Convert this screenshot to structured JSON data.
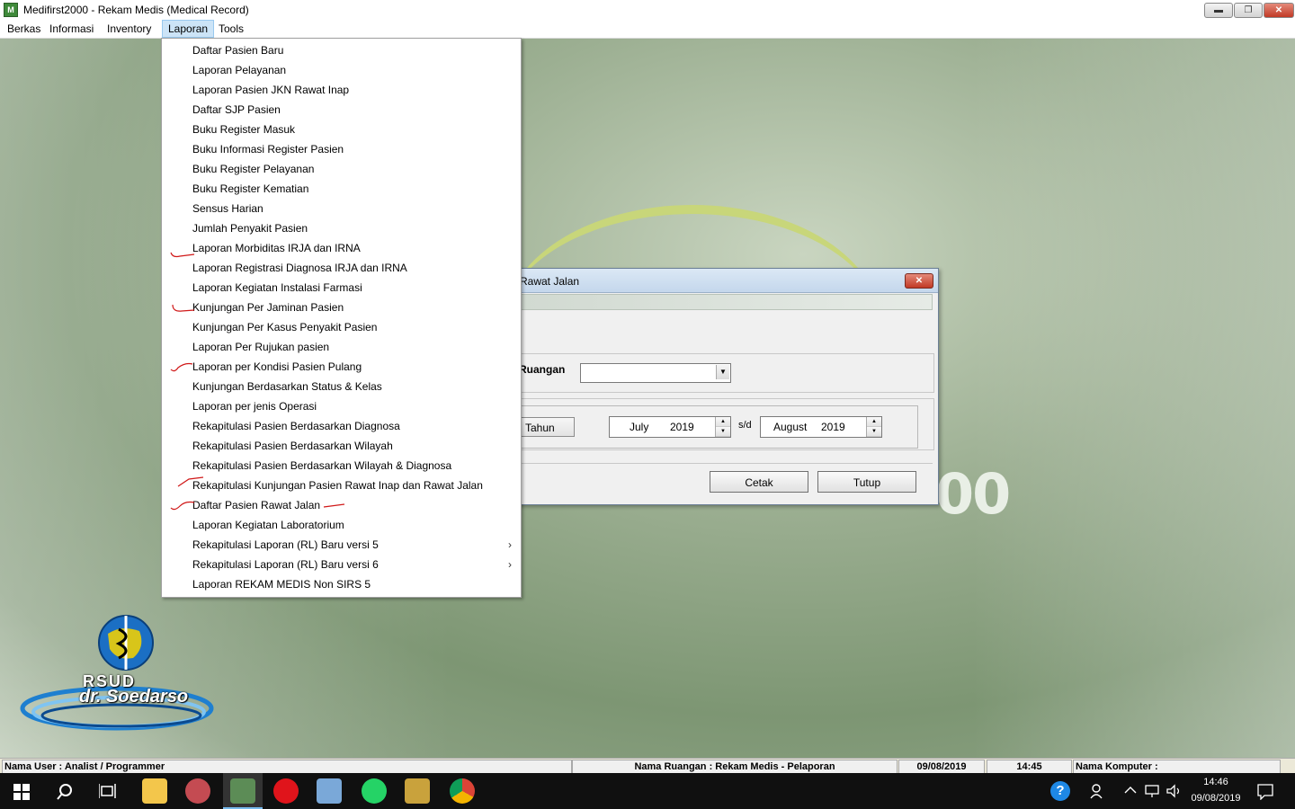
{
  "window": {
    "title": "Medifirst2000 - Rekam Medis (Medical Record)",
    "minimize": "▬",
    "restore": "❐",
    "close": "✕"
  },
  "menubar": {
    "items": [
      "Berkas",
      "Informasi",
      "Inventory",
      "Laporan",
      "Tools"
    ],
    "active": "Laporan"
  },
  "background": {
    "brand_fragment": "00",
    "copyright": "©",
    "hospital_logo": {
      "line1": "RSUD",
      "line2": "dr. Soedarso"
    }
  },
  "laporan_menu": {
    "items": [
      {
        "label": "Daftar Pasien Baru"
      },
      {
        "label": "Laporan Pelayanan"
      },
      {
        "label": "Laporan Pasien JKN Rawat Inap"
      },
      {
        "label": "Daftar SJP Pasien"
      },
      {
        "label": "Buku Register Masuk"
      },
      {
        "label": "Buku Informasi Register Pasien"
      },
      {
        "label": "Buku Register Pelayanan"
      },
      {
        "label": "Buku Register Kematian"
      },
      {
        "label": "Sensus Harian"
      },
      {
        "label": "Jumlah Penyakit Pasien"
      },
      {
        "label": "Laporan Morbiditas IRJA dan IRNA"
      },
      {
        "label": "Laporan Registrasi Diagnosa IRJA dan IRNA"
      },
      {
        "label": "Laporan Kegiatan Instalasi Farmasi"
      },
      {
        "label": "Kunjungan Per Jaminan Pasien"
      },
      {
        "label": "Kunjungan Per Kasus Penyakit Pasien"
      },
      {
        "label": "Laporan Per Rujukan pasien"
      },
      {
        "label": "Laporan per Kondisi Pasien Pulang"
      },
      {
        "label": "Kunjungan Berdasarkan Status & Kelas"
      },
      {
        "label": "Laporan per jenis Operasi"
      },
      {
        "label": "Rekapitulasi Pasien Berdasarkan Diagnosa"
      },
      {
        "label": "Rekapitulasi Pasien Berdasarkan Wilayah"
      },
      {
        "label": "Rekapitulasi Pasien Berdasarkan Wilayah & Diagnosa"
      },
      {
        "label": "Rekapitulasi Kunjungan Pasien Rawat Inap dan Rawat Jalan"
      },
      {
        "label": "Daftar Pasien Rawat Jalan"
      },
      {
        "label": "Laporan Kegiatan Laboratorium"
      },
      {
        "label": "Rekapitulasi Laporan (RL) Baru versi 5",
        "submenu": "›"
      },
      {
        "label": "Rekapitulasi Laporan (RL) Baru versi 6",
        "submenu": "›"
      },
      {
        "label": "Laporan REKAM MEDIS Non SIRS 5"
      }
    ]
  },
  "dialog": {
    "title": "Rawat Jalan",
    "close": "✕",
    "ruangan_label": "Ruangan",
    "ruangan_value": "",
    "combo_arrow": "▼",
    "tahun_label": "Tahun",
    "from": {
      "month": "July",
      "year": "2019"
    },
    "sd": "s/d",
    "to": {
      "month": "August",
      "year": "2019"
    },
    "spin_up": "▲",
    "spin_down": "▼",
    "cetak": "Cetak",
    "tutup": "Tutup"
  },
  "statusbar": {
    "user": "Nama User : Analist / Programmer",
    "ruangan": "Nama Ruangan : Rekam Medis - Pelaporan",
    "date": "09/08/2019",
    "time": "14:45",
    "komputer": "Nama Komputer :"
  },
  "taskbar": {
    "clock_time": "14:46",
    "clock_date": "09/08/2019",
    "help": "?"
  }
}
